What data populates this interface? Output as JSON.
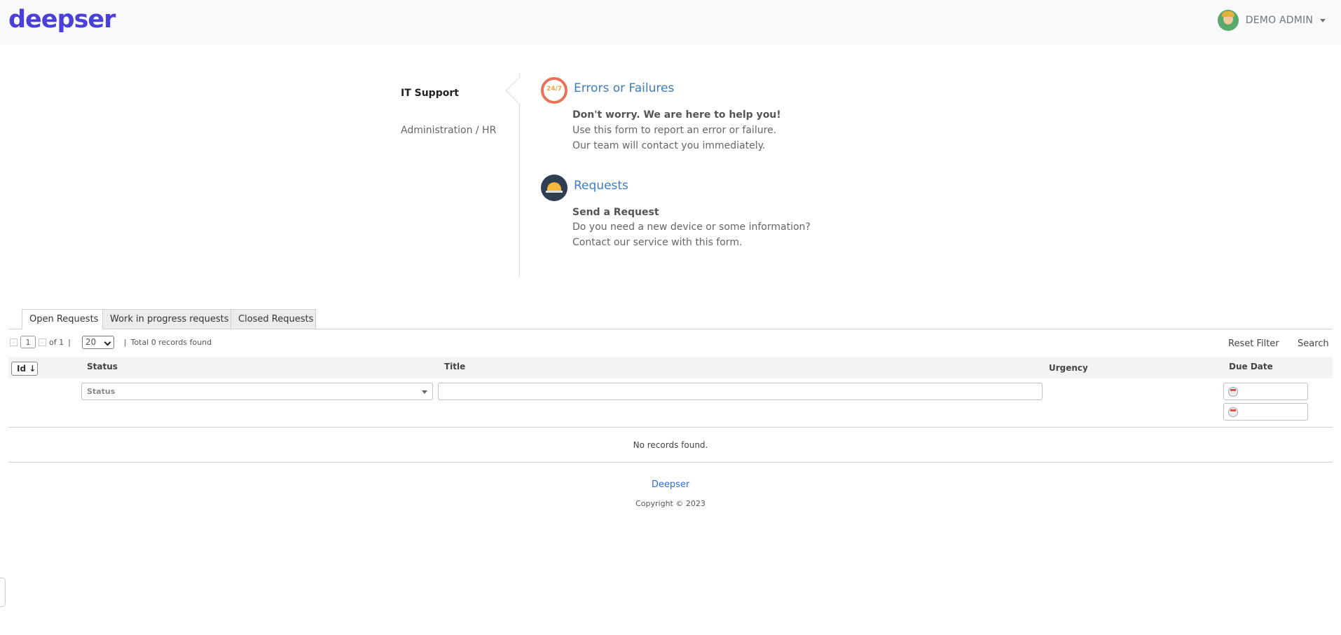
{
  "header": {
    "logo": "deepser",
    "user_name": "DEMO ADMIN"
  },
  "categories": [
    {
      "label": "IT Support",
      "active": true
    },
    {
      "label": "Administration / HR",
      "active": false
    }
  ],
  "services": [
    {
      "title": "Errors or Failures",
      "subtitle": "Don't worry. We are here to help you!",
      "lines": [
        "Use this form to report an error or failure.",
        "Our team will contact you immediately."
      ],
      "icon": "support-24-7-icon"
    },
    {
      "title": "Requests",
      "subtitle": "Send a Request",
      "lines": [
        "Do you need a new device or some information?",
        "Contact our service with this form."
      ],
      "icon": "service-bell-icon"
    }
  ],
  "tabs": [
    {
      "label": "Open Requests",
      "active": true
    },
    {
      "label": "Work in progress requests",
      "active": false
    },
    {
      "label": "Closed Requests",
      "active": false
    }
  ],
  "pager": {
    "page": "1",
    "of_text": "of 1",
    "page_size": "20",
    "total_text": "Total 0 records found",
    "separator": "|"
  },
  "actions": {
    "reset_filter": "Reset Filter",
    "search": "Search"
  },
  "grid": {
    "columns": {
      "id": "Id",
      "status": "Status",
      "title": "Title",
      "urgency": "Urgency",
      "due_date": "Due Date"
    },
    "status_placeholder": "Status",
    "empty_text": "No records found."
  },
  "footer": {
    "link": "Deepser",
    "copyright": "Copyright © 2023"
  }
}
